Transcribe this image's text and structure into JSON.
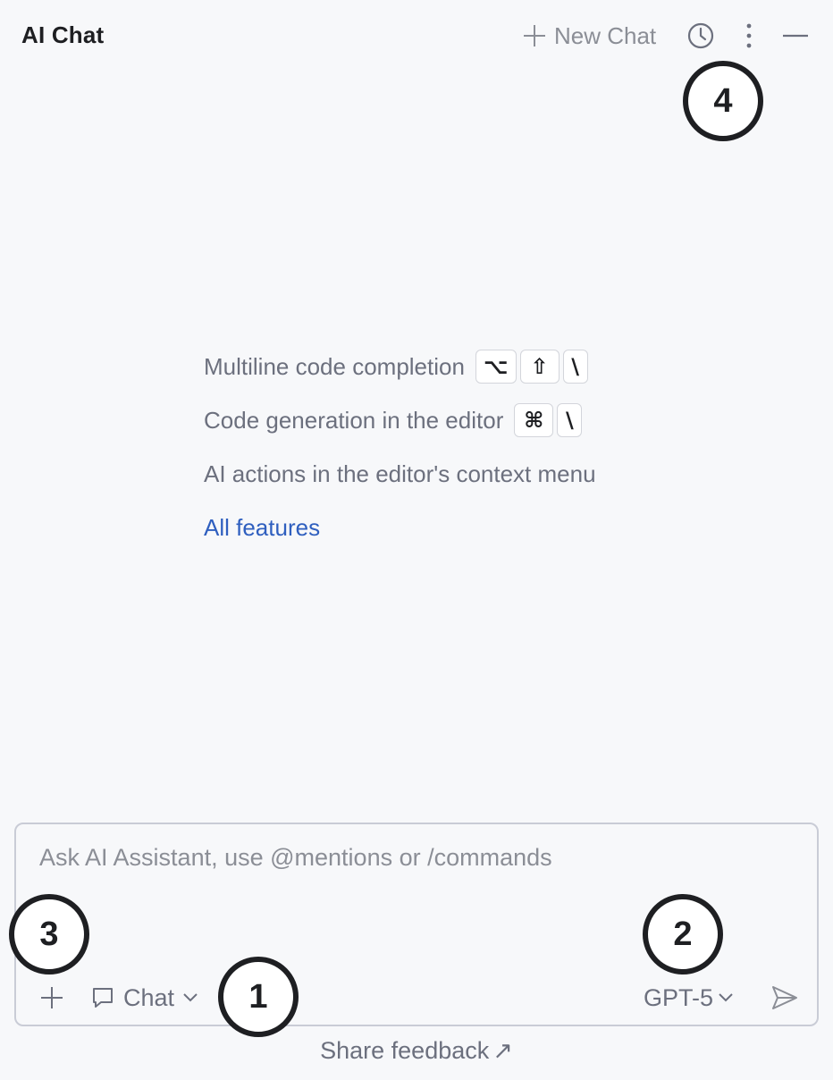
{
  "header": {
    "title": "AI Chat",
    "new_chat_label": "New Chat",
    "icons": [
      "plus-icon",
      "clock-icon",
      "more-vertical-icon",
      "minimize-icon"
    ]
  },
  "tips": {
    "items": [
      {
        "label": "Multiline code completion",
        "keys": [
          "⌥",
          "⇧",
          "\\"
        ]
      },
      {
        "label": "Code generation in the editor",
        "keys": [
          "⌘",
          "\\"
        ]
      },
      {
        "label": "AI actions in the editor's context menu",
        "keys": []
      }
    ],
    "all_features_link": "All features"
  },
  "input": {
    "placeholder": "Ask AI Assistant, use @mentions or /commands",
    "value": "",
    "mode_label": "Chat",
    "model_label": "GPT-5"
  },
  "footer": {
    "feedback_label": "Share feedback",
    "feedback_arrow": "↗"
  },
  "callouts": {
    "one": "1",
    "two": "2",
    "three": "3",
    "four": "4"
  },
  "colors": {
    "background": "#f7f8fa",
    "link": "#2f5fbf",
    "muted_text": "#6c707e",
    "border": "#c9ccd6"
  }
}
